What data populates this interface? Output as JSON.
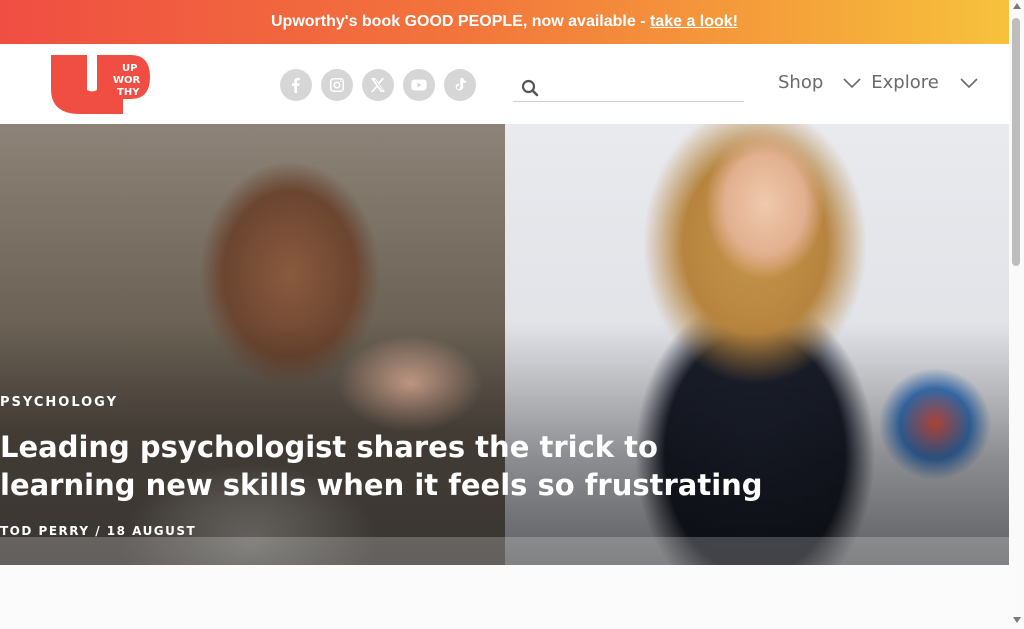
{
  "banner": {
    "text": "Upworthy's book GOOD PEOPLE, now available - ",
    "link": "take a look!"
  },
  "logo": {
    "line1": "UP",
    "line2": "WOR",
    "line3": "THY",
    "color": "#f04e42"
  },
  "social": [
    {
      "icon": "facebook-icon"
    },
    {
      "icon": "instagram-icon"
    },
    {
      "icon": "x-twitter-icon"
    },
    {
      "icon": "youtube-icon"
    },
    {
      "icon": "tiktok-icon"
    }
  ],
  "search": {
    "placeholder": "",
    "value": ""
  },
  "nav": {
    "shop": "Shop",
    "explore": "Explore"
  },
  "hero": {
    "category": "PSYCHOLOGY",
    "headline": "Leading psychologist shares the trick to learning new skills when it feels so frustrating",
    "byline": "TOD PERRY / 18 AUGUST"
  },
  "colors": {
    "accent": "#f04e42",
    "banner_end": "#f6c23c"
  }
}
